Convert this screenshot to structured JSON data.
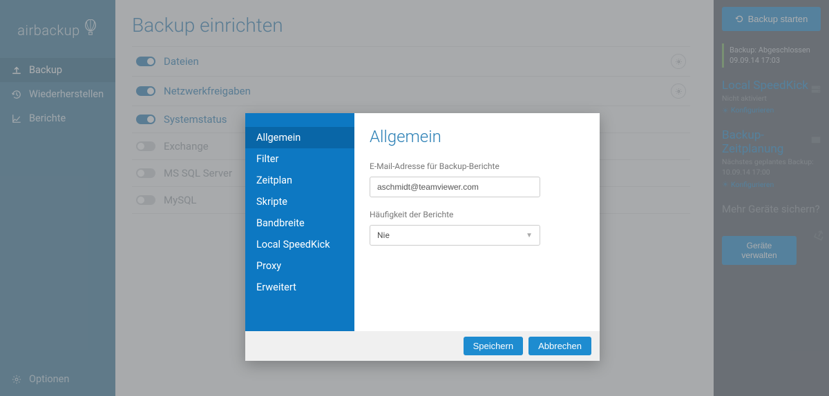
{
  "brand": "airbackup",
  "nav": [
    {
      "label": "Backup",
      "active": true
    },
    {
      "label": "Wiederherstellen",
      "active": false
    },
    {
      "label": "Berichte",
      "active": false
    }
  ],
  "footer": {
    "options": "Optionen"
  },
  "page": {
    "title": "Backup einrichten"
  },
  "rows": [
    {
      "label": "Dateien",
      "on": true,
      "muted": false,
      "gear": true
    },
    {
      "label": "Netzwerkfreigaben",
      "on": true,
      "muted": false,
      "gear": true
    },
    {
      "label": "Systemstatus",
      "on": true,
      "muted": false,
      "gear": false
    },
    {
      "label": "Exchange",
      "on": false,
      "muted": true,
      "gear": false
    },
    {
      "label": "MS SQL Server",
      "on": false,
      "muted": true,
      "gear": false
    },
    {
      "label": "MySQL",
      "on": false,
      "muted": true,
      "gear": false
    }
  ],
  "right": {
    "start": "Backup starten",
    "status": {
      "line1": "Backup: Abgeschlossen",
      "line2": "09.09.14 17:03"
    },
    "speedkick": {
      "title": "Local SpeedKick",
      "sub": "Nicht aktiviert",
      "link": "Konfigurieren"
    },
    "schedule": {
      "title": "Backup-Zeitplanung",
      "sub1": "Nächstes geplantes Backup:",
      "sub2": "10.09.14 17:00",
      "link": "Konfigurieren"
    },
    "more": "Mehr Geräte sichern?",
    "manage": "Geräte verwalten"
  },
  "modal": {
    "nav": [
      "Allgemein",
      "Filter",
      "Zeitplan",
      "Skripte",
      "Bandbreite",
      "Local SpeedKick",
      "Proxy",
      "Erweitert"
    ],
    "activeIndex": 0,
    "title": "Allgemein",
    "emailLabel": "E-Mail-Adresse für Backup-Berichte",
    "emailValue": "aschmidt@teamviewer.com",
    "freqLabel": "Häufigkeit der Berichte",
    "freqValue": "Nie",
    "save": "Speichern",
    "cancel": "Abbrechen"
  }
}
